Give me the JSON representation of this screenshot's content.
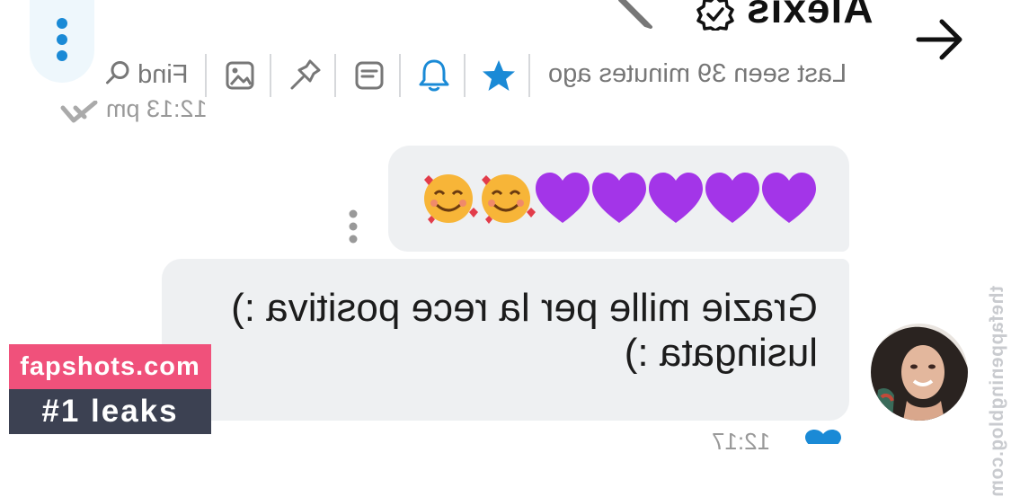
{
  "header": {
    "title": "Alexis",
    "status": "Last seen 39 minutes ago",
    "find_label": "Find",
    "icons": [
      "back-arrow-icon",
      "verified-badge-icon",
      "edit-pencil-icon",
      "star-icon",
      "bell-icon",
      "pin-icon",
      "image-icon",
      "search-icon",
      "more-options-icon"
    ]
  },
  "conversation": {
    "previous_time": "12:13 pm",
    "messages": [
      {
        "side": "out",
        "text": "🥰🥰💜💜💜💜💜",
        "kind": "emoji"
      },
      {
        "side": "out",
        "text": "Grazie mille per la rece positiva :) lusingata :)"
      }
    ],
    "bottom_time": "12:17"
  },
  "watermark": {
    "site": "fapshots.com",
    "tagline": "#1 leaks",
    "side_text": "thefappeningblog.com"
  },
  "colors": {
    "accent": "#1a8ad6",
    "bubble": "#eef0f2",
    "heart": "#a335e8",
    "brand_pink": "#f0517b",
    "brand_dark": "#3c4152"
  }
}
